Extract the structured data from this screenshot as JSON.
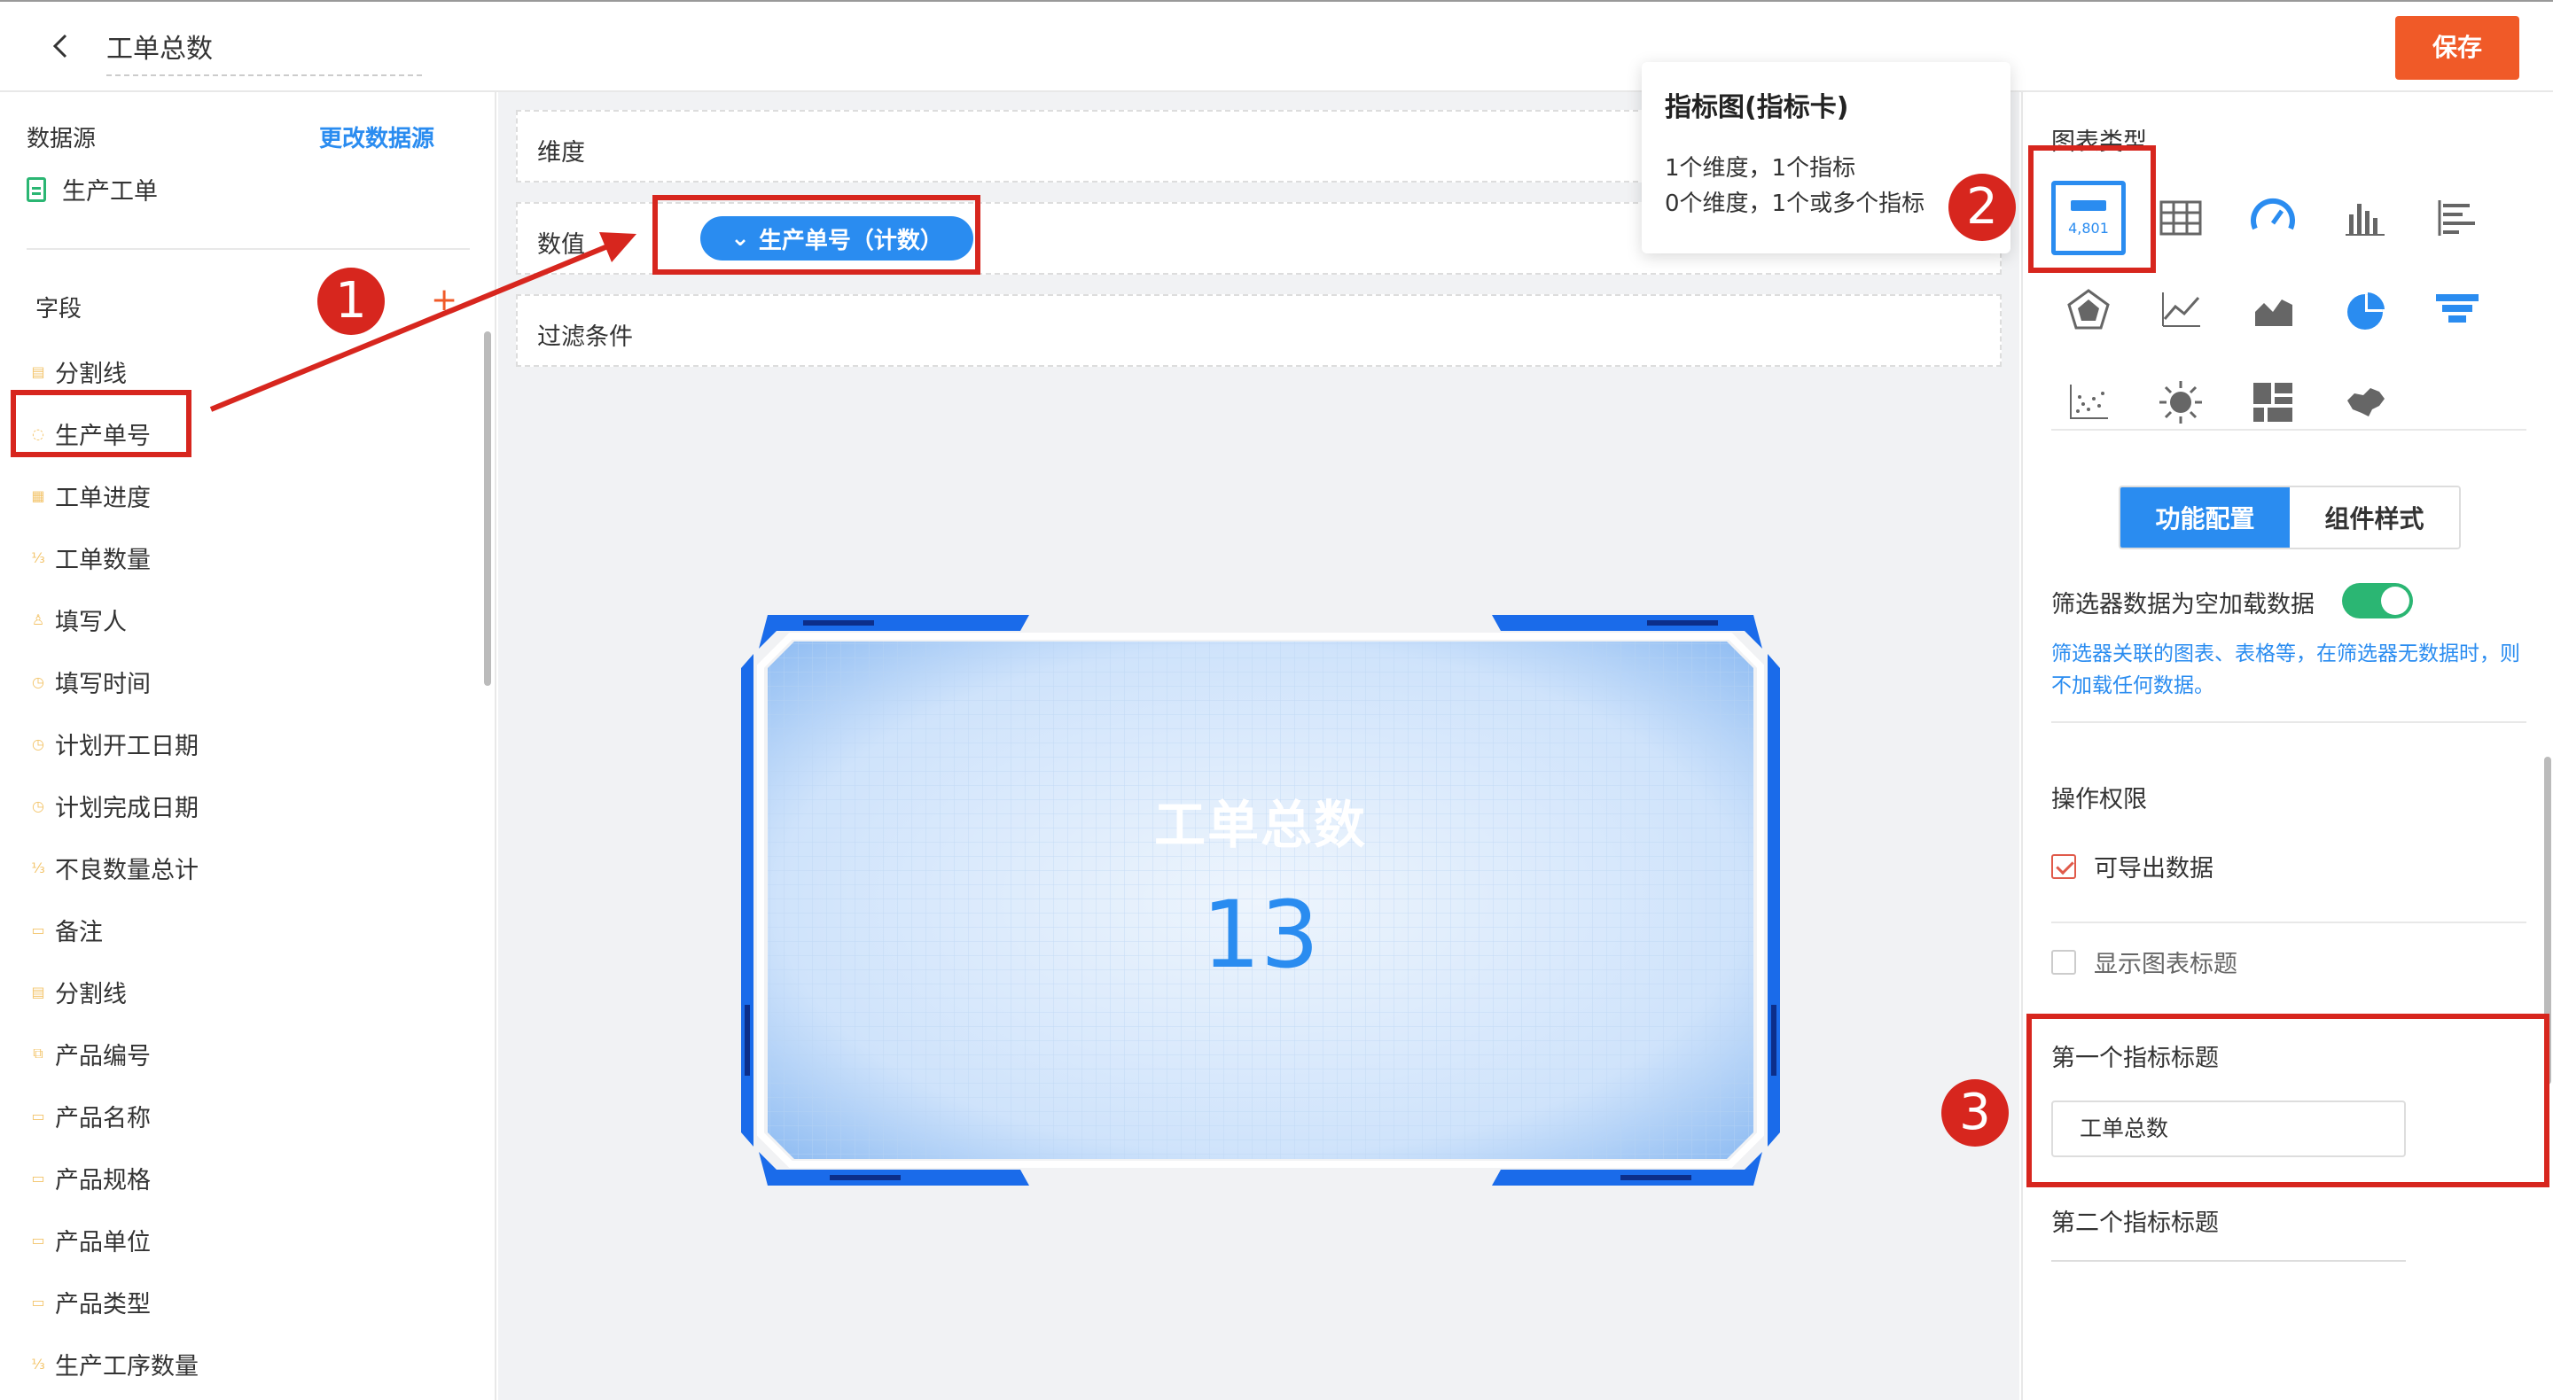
{
  "topbar": {
    "title": "工单总数",
    "save_label": "保存"
  },
  "datasource": {
    "label": "数据源",
    "change_label": "更改数据源",
    "item": "生产工单"
  },
  "fields": {
    "label": "字段",
    "add": "+",
    "items": [
      {
        "label": "分割线",
        "icon": "divider-icon"
      },
      {
        "label": "生产单号",
        "icon": "serial-icon"
      },
      {
        "label": "工单进度",
        "icon": "progress-icon"
      },
      {
        "label": "工单数量",
        "icon": "number-icon"
      },
      {
        "label": "填写人",
        "icon": "user-icon"
      },
      {
        "label": "填写时间",
        "icon": "clock-icon"
      },
      {
        "label": "计划开工日期",
        "icon": "clock-icon"
      },
      {
        "label": "计划完成日期",
        "icon": "clock-icon"
      },
      {
        "label": "不良数量总计",
        "icon": "number-icon"
      },
      {
        "label": "备注",
        "icon": "text-icon"
      },
      {
        "label": "分割线",
        "icon": "divider-icon"
      },
      {
        "label": "产品编号",
        "icon": "link-icon"
      },
      {
        "label": "产品名称",
        "icon": "text-icon"
      },
      {
        "label": "产品规格",
        "icon": "text-icon"
      },
      {
        "label": "产品单位",
        "icon": "text-icon"
      },
      {
        "label": "产品类型",
        "icon": "text-icon"
      },
      {
        "label": "生产工序数量",
        "icon": "number-icon"
      }
    ]
  },
  "center": {
    "dimension_label": "维度",
    "value_label": "数值",
    "value_pill": "生产单号（计数）",
    "filter_label": "过滤条件",
    "card_title": "工单总数",
    "card_value": "13"
  },
  "tooltip": {
    "title": "指标图(指标卡)",
    "line1": "1个维度，1个指标",
    "line2": "0个维度，1个或多个指标"
  },
  "right": {
    "chart_type_label": "图表类型",
    "active_chart_sample": "4,801",
    "tab_config": "功能配置",
    "tab_style": "组件样式",
    "filter_toggle_label": "筛选器数据为空加载数据",
    "filter_hint": "筛选器关联的图表、表格等，在筛选器无数据时，则不加载任何数据。",
    "permission_label": "操作权限",
    "export_label": "可导出数据",
    "show_title_label": "显示图表标题",
    "first_metric_label": "第一个指标标题",
    "first_metric_value": "工单总数",
    "second_metric_label": "第二个指标标题"
  },
  "annotations": {
    "n1": "1",
    "n2": "2",
    "n3": "3"
  },
  "colors": {
    "accent": "#2a8cf0",
    "save": "#f05a28",
    "annotation": "#d7261e",
    "toggle": "#2bb673"
  }
}
